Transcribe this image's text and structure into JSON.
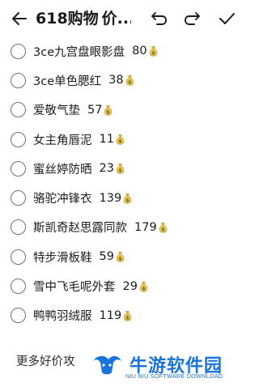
{
  "toolbar": {
    "title_prefix": "618购物",
    "title_emoji": "shopping-bags-emoji",
    "title_suffix": "价...",
    "icons": {
      "back": "back-arrow-icon",
      "undo": "undo-icon",
      "redo": "redo-icon",
      "done": "check-icon"
    }
  },
  "checklist": {
    "items": [
      {
        "name": "3ce九宫盘眼影盘",
        "price": "80",
        "checked": false,
        "icon": "money-bag-emoji"
      },
      {
        "name": "3ce单色腮红",
        "price": "38",
        "checked": false,
        "icon": "money-bag-emoji"
      },
      {
        "name": "爱敬气垫",
        "price": "57",
        "checked": false,
        "icon": "money-bag-emoji"
      },
      {
        "name": "女主角唇泥",
        "price": "11",
        "checked": false,
        "icon": "money-bag-emoji"
      },
      {
        "name": "蜜丝婷防晒",
        "price": "23",
        "checked": false,
        "icon": "money-bag-emoji"
      },
      {
        "name": "骆驼冲锋衣",
        "price": "139",
        "checked": false,
        "icon": "money-bag-emoji"
      },
      {
        "name": "斯凯奇赵思露同款",
        "price": "179",
        "checked": false,
        "icon": "money-bag-emoji"
      },
      {
        "name": "特步滑板鞋",
        "price": "59",
        "checked": false,
        "icon": "money-bag-emoji"
      },
      {
        "name": "雪中飞毛呢外套",
        "price": "29",
        "checked": false,
        "icon": "money-bag-emoji"
      },
      {
        "name": "鸭鸭羽绒服",
        "price": "119",
        "checked": false,
        "icon": "money-bag-emoji"
      }
    ]
  },
  "footer": {
    "text": "更多好价攻"
  },
  "watermark": {
    "name": "牛游软件园",
    "subtitle": "NIU NIU SOFTWARE DOWNLOAD",
    "logo": "niuyou-logo"
  },
  "colors": {
    "checkbox_border": "#6f6f6f",
    "watermark_blue": "#1a73d8"
  }
}
